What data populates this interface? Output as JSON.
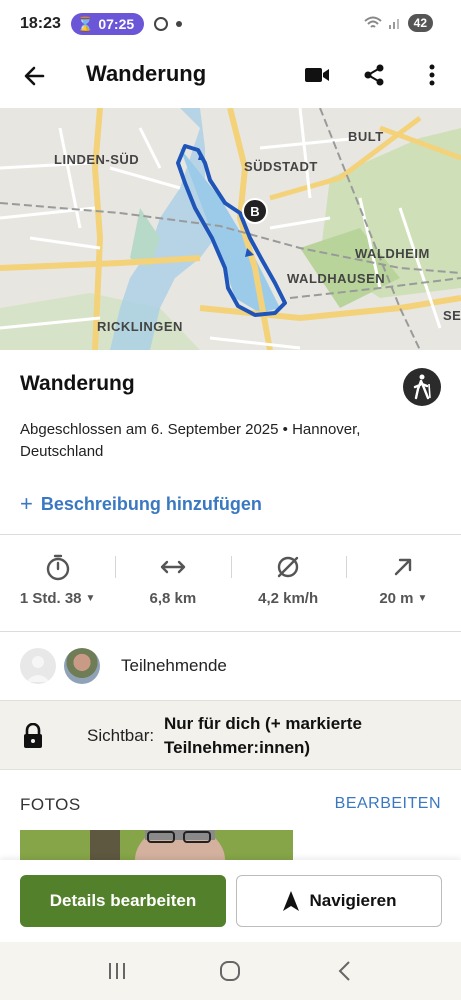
{
  "status": {
    "time": "18:23",
    "timer": "07:25",
    "battery": "42"
  },
  "app_bar": {
    "title": "Wanderung"
  },
  "map": {
    "labels": {
      "linden_sued": "LINDEN-SÜD",
      "suedstadt": "SÜDSTADT",
      "bult": "BULT",
      "waldheim": "WALDHEIM",
      "waldhausen": "WALDHAUSEN",
      "ricklingen": "RICKLINGEN",
      "se": "SE"
    },
    "marker_b": "B"
  },
  "activity": {
    "title": "Wanderung",
    "completed": "Abgeschlossen am 6. September 2025 • Hannover, Deutschland",
    "add_description": "Beschreibung hinzufügen"
  },
  "stats": {
    "duration": "1 Std. 38",
    "distance": "6,8 km",
    "speed": "4,2 km/h",
    "elevation": "20 m"
  },
  "participants": {
    "label": "Teilnehmende"
  },
  "visibility": {
    "label": "Sichtbar:",
    "value": "Nur für dich (+ markierte Teilnehmer:innen)"
  },
  "photos": {
    "title": "FOTOS",
    "edit": "BEARBEITEN"
  },
  "actions": {
    "edit_details": "Details bearbeiten",
    "navigate": "Navigieren"
  },
  "colors": {
    "primary": "#53802a",
    "link": "#3b78c2",
    "route": "#1f55b8",
    "timer": "#6b56d8"
  }
}
